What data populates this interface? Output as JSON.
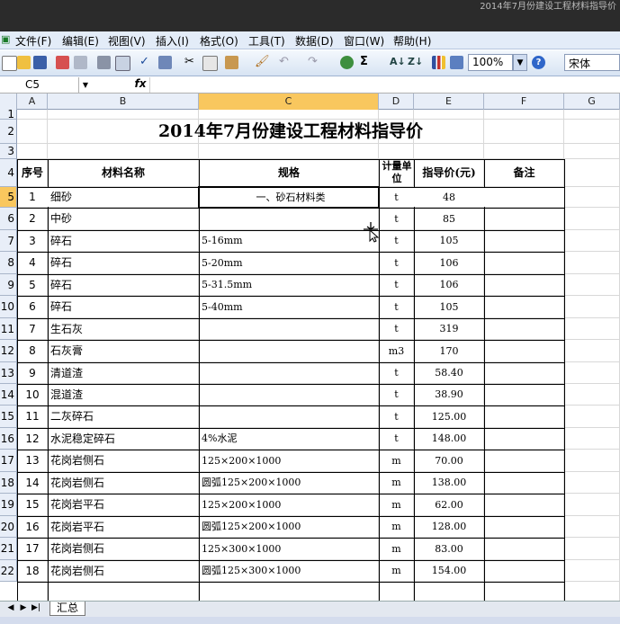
{
  "window": {
    "title": "2014年7月份建设工程材料指导价"
  },
  "menu": [
    "文件(F)",
    "编辑(E)",
    "视图(V)",
    "插入(I)",
    "格式(O)",
    "工具(T)",
    "数据(D)",
    "窗口(W)",
    "帮助(H)"
  ],
  "toolbar": {
    "zoom": "100%",
    "font": "宋体",
    "sum_symbol": "Σ",
    "icons": [
      "new-icon",
      "open-icon",
      "save-icon",
      "permission-icon",
      "email-icon",
      "print-icon",
      "print-preview-icon",
      "spelling-icon",
      "research-icon",
      "cut-icon",
      "copy-icon",
      "paste-icon",
      "format-painter-icon",
      "undo-icon",
      "redo-icon",
      "hyperlink-icon",
      "autosum-icon",
      "sort-asc-icon",
      "sort-desc-icon",
      "chart-icon",
      "drawing-icon",
      "help-icon"
    ]
  },
  "formula_bar": {
    "name_box": "C5",
    "fx": "fx",
    "value": ""
  },
  "columns": [
    "A",
    "B",
    "C",
    "D",
    "E",
    "F",
    "G"
  ],
  "selected_column": "C",
  "selected_row": "5",
  "row_numbers": [
    "1",
    "2",
    "3",
    "4",
    "5",
    "6",
    "7",
    "8",
    "9",
    "10",
    "11",
    "12",
    "13",
    "14",
    "15",
    "16",
    "17",
    "18",
    "19",
    "20",
    "21",
    "22"
  ],
  "sheet": {
    "title": "2014年7月份建设工程材料指导价",
    "headers": {
      "seq": "序号",
      "name": "材料名称",
      "spec": "规格",
      "unit": "计量单位",
      "price": "指导价(元)",
      "note": "备注"
    },
    "section": "一、砂石材料类",
    "rows": [
      {
        "seq": "1",
        "name": "细砂",
        "spec": "",
        "unit": "t",
        "price": "48",
        "note": ""
      },
      {
        "seq": "2",
        "name": "中砂",
        "spec": "",
        "unit": "t",
        "price": "85",
        "note": ""
      },
      {
        "seq": "3",
        "name": "碎石",
        "spec": "5-16mm",
        "unit": "t",
        "price": "105",
        "note": ""
      },
      {
        "seq": "4",
        "name": "碎石",
        "spec": "5-20mm",
        "unit": "t",
        "price": "106",
        "note": ""
      },
      {
        "seq": "5",
        "name": "碎石",
        "spec": "5-31.5mm",
        "unit": "t",
        "price": "106",
        "note": ""
      },
      {
        "seq": "6",
        "name": "碎石",
        "spec": "5-40mm",
        "unit": "t",
        "price": "105",
        "note": ""
      },
      {
        "seq": "7",
        "name": "生石灰",
        "spec": "",
        "unit": "t",
        "price": "319",
        "note": ""
      },
      {
        "seq": "8",
        "name": "石灰膏",
        "spec": "",
        "unit": "m3",
        "price": "170",
        "note": ""
      },
      {
        "seq": "9",
        "name": "清道渣",
        "spec": "",
        "unit": "t",
        "price": "58.40",
        "note": ""
      },
      {
        "seq": "10",
        "name": "混道渣",
        "spec": "",
        "unit": "t",
        "price": "38.90",
        "note": ""
      },
      {
        "seq": "11",
        "name": "二灰碎石",
        "spec": "",
        "unit": "t",
        "price": "125.00",
        "note": ""
      },
      {
        "seq": "12",
        "name": "水泥稳定碎石",
        "spec": "4%水泥",
        "unit": "t",
        "price": "148.00",
        "note": ""
      },
      {
        "seq": "13",
        "name": "花岗岩侧石",
        "spec": "125×200×1000",
        "unit": "m",
        "price": "70.00",
        "note": ""
      },
      {
        "seq": "14",
        "name": "花岗岩侧石",
        "spec": "圆弧125×200×1000",
        "unit": "m",
        "price": "138.00",
        "note": ""
      },
      {
        "seq": "15",
        "name": "花岗岩平石",
        "spec": "125×200×1000",
        "unit": "m",
        "price": "62.00",
        "note": ""
      },
      {
        "seq": "16",
        "name": "花岗岩平石",
        "spec": "圆弧125×200×1000",
        "unit": "m",
        "price": "128.00",
        "note": ""
      },
      {
        "seq": "17",
        "name": "花岗岩侧石",
        "spec": "125×300×1000",
        "unit": "m",
        "price": "83.00",
        "note": ""
      },
      {
        "seq": "18",
        "name": "花岗岩侧石",
        "spec": "圆弧125×300×1000",
        "unit": "m",
        "price": "154.00",
        "note": ""
      }
    ]
  },
  "sheet_tabs": [
    "汇总"
  ],
  "colors": {
    "selection": "#f9c75e",
    "header_bg": "#e8eef8",
    "menu_bg": "#e3ecf8"
  }
}
